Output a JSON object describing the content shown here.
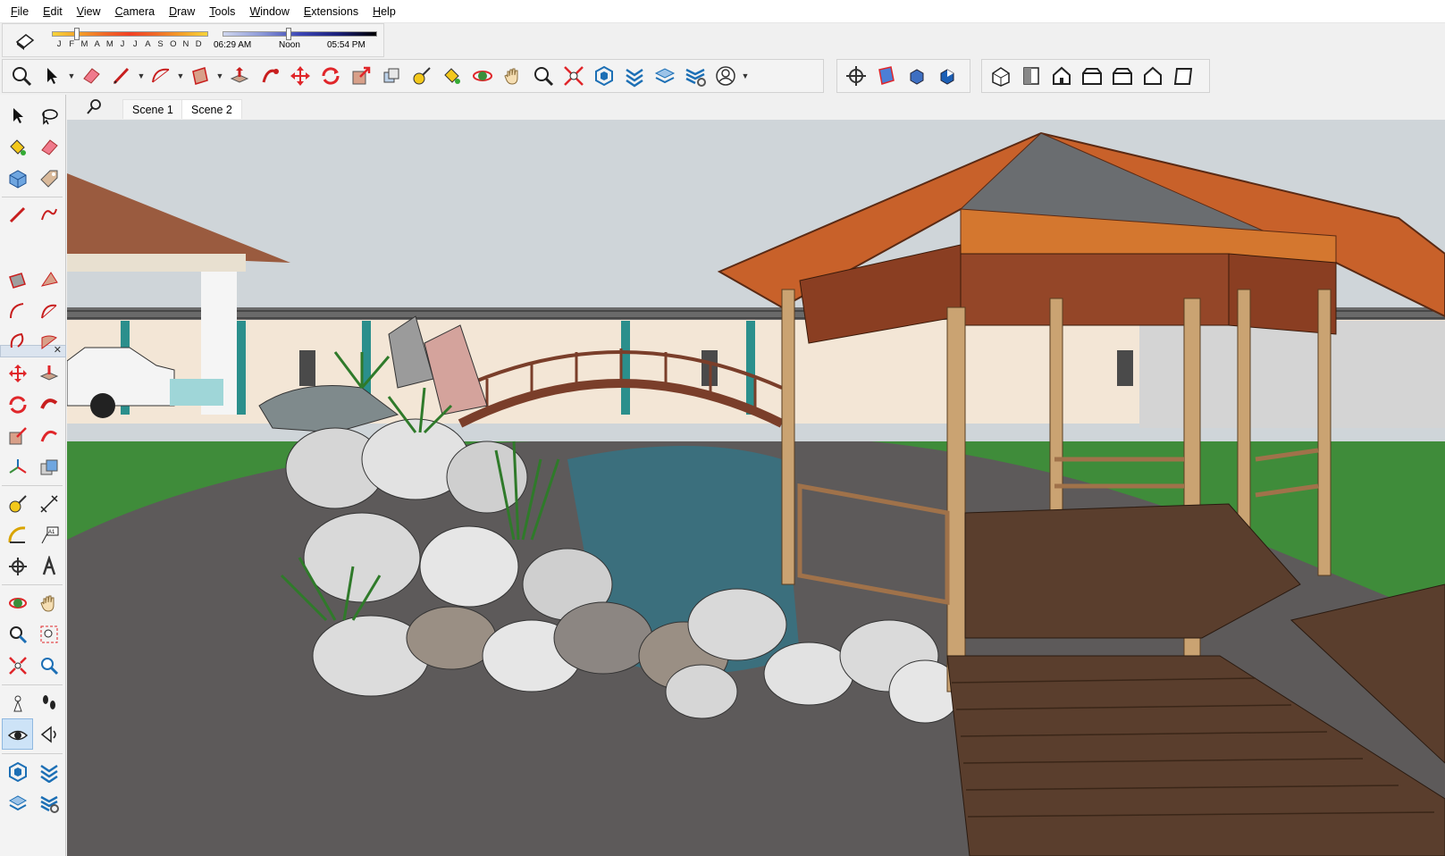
{
  "menu": {
    "items": [
      "File",
      "Edit",
      "View",
      "Camera",
      "Draw",
      "Tools",
      "Window",
      "Extensions",
      "Help"
    ]
  },
  "shadows": {
    "months": [
      "J",
      "F",
      "M",
      "A",
      "M",
      "J",
      "J",
      "A",
      "S",
      "O",
      "N",
      "D"
    ],
    "time_start": "06:29 AM",
    "time_noon": "Noon",
    "time_end": "05:54 PM",
    "date_position": 0.16,
    "time_position": 0.43
  },
  "scenes": {
    "tabs": [
      "Scene 1",
      "Scene 2"
    ],
    "active": "Scene 2"
  },
  "colors": {
    "sky": "#cfd5d9",
    "ground": "#5d5a5a",
    "grass": "#3f8c3a",
    "roof": "#c8612a",
    "water": "#3b6f7d",
    "deck": "#5a3e2d",
    "selection": "#cde3f7"
  }
}
